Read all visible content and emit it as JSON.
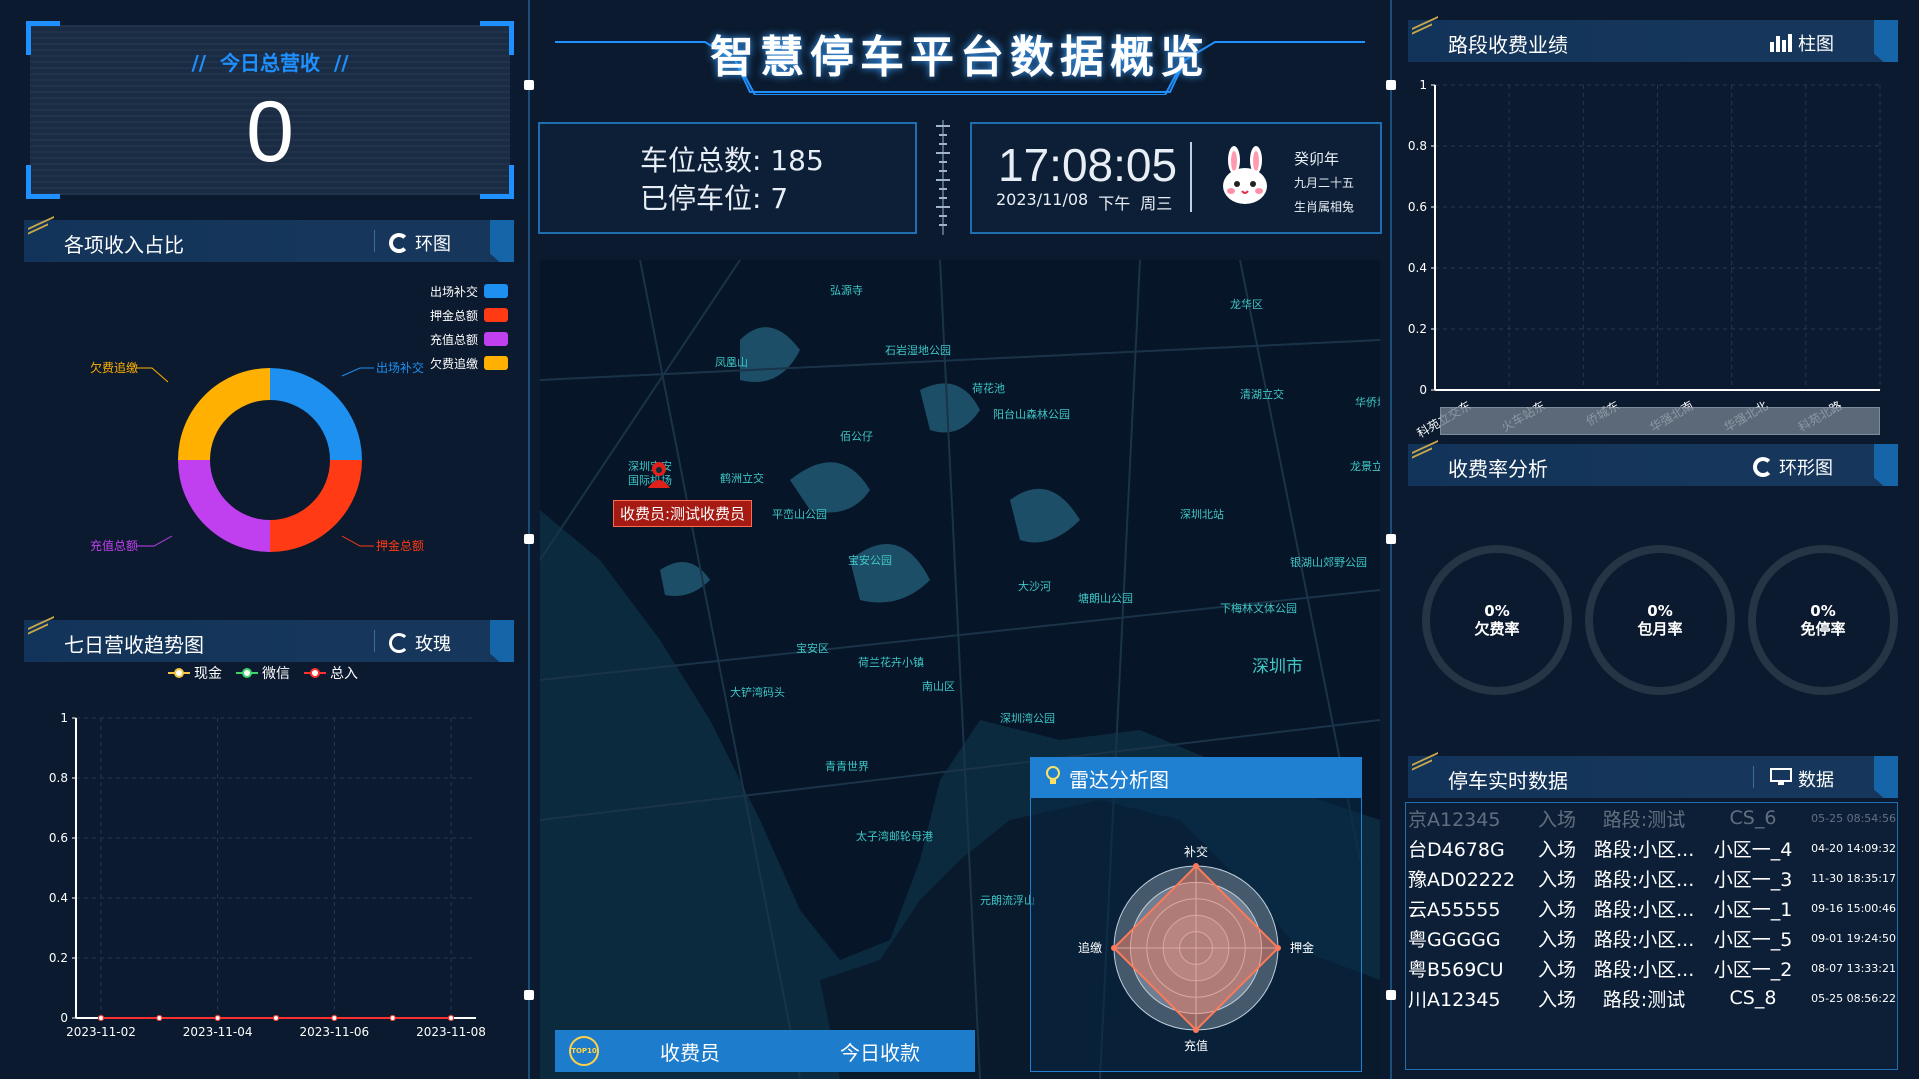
{
  "title": "智慧停车平台数据概览",
  "revenue": {
    "title": "今日总营收",
    "value": "0"
  },
  "income_panel": {
    "title": "各项收入占比",
    "switch_label": "环图",
    "legend": [
      {
        "label": "出场补交",
        "color": "#1e90f0"
      },
      {
        "label": "押金总额",
        "color": "#ff3a14"
      },
      {
        "label": "充值总额",
        "color": "#c040f0"
      },
      {
        "label": "欠费追缴",
        "color": "#ffb000"
      }
    ],
    "slice_labels": [
      "欠费追缴",
      "出场补交",
      "充值总额",
      "押金总额"
    ]
  },
  "trend_panel": {
    "title": "七日营收趋势图",
    "switch_label": "玫瑰",
    "legend": [
      {
        "label": "现金",
        "color": "#f5c542"
      },
      {
        "label": "微信",
        "color": "#3fd36b"
      },
      {
        "label": "总入",
        "color": "#ff3030"
      }
    ],
    "y_ticks": [
      "1",
      "0.8",
      "0.6",
      "0.4",
      "0.2",
      "0"
    ],
    "x_ticks": [
      "2023-11-02",
      "2023-11-04",
      "2023-11-06",
      "2023-11-08"
    ]
  },
  "stats": {
    "total_spaces": "车位总数: 185",
    "occupied": "已停车位: 7"
  },
  "clock": {
    "time": "17:08:05",
    "date": "2023/11/08",
    "ampm": "下午",
    "weekday": "周三",
    "lunar_year": "癸卯年",
    "lunar_date": "九月二十五",
    "zodiac": "生肖属相兔"
  },
  "map": {
    "labels": [
      {
        "text": "弘源寺"
      },
      {
        "text": "石岩湿地公园"
      },
      {
        "text": "凤凰山"
      },
      {
        "text": "荷花池"
      },
      {
        "text": "阳台山森林公园"
      },
      {
        "text": "清湖立交"
      },
      {
        "text": "华侨城"
      },
      {
        "text": "佰公仔"
      },
      {
        "text": "深圳宝安"
      },
      {
        "text": "国际机场"
      },
      {
        "text": "鹤洲立交"
      },
      {
        "text": "平峦山公园"
      },
      {
        "text": "深圳北站"
      },
      {
        "text": "银湖山郊野公园"
      },
      {
        "text": "塘朗山公园"
      },
      {
        "text": "下梅林文体公园"
      },
      {
        "text": "宝安区"
      },
      {
        "text": "荷兰花卉小镇"
      },
      {
        "text": "大铲湾码头"
      },
      {
        "text": "南山区"
      },
      {
        "text": "深圳湾公园"
      },
      {
        "text": "青青世界"
      },
      {
        "text": "太子湾邮轮母港"
      },
      {
        "text": "元朗流浮山"
      },
      {
        "text": "深圳市"
      },
      {
        "text": "大沙河"
      },
      {
        "text": "龙华区"
      },
      {
        "text": "龙景立"
      },
      {
        "text": "宝安公园"
      }
    ],
    "collector_label": "收费员:测试收费员"
  },
  "radar": {
    "title": "雷达分析图",
    "axes": [
      "补交",
      "押金",
      "充值",
      "追缴"
    ],
    "chart_data": {
      "type": "radar",
      "axes": [
        "补交",
        "押金",
        "充值",
        "追缴"
      ],
      "values": [
        1,
        1,
        1,
        1
      ]
    }
  },
  "top10": {
    "col1": "收费员",
    "col2": "今日收款",
    "badge": "TOP10"
  },
  "segment_panel": {
    "title": "路段收费业绩",
    "switch_label": "柱图",
    "y_ticks": [
      "1",
      "0.8",
      "0.6",
      "0.4",
      "0.2",
      "0"
    ],
    "x_ticks": [
      "科苑立交东",
      "火车站东",
      "侨城东",
      "华强北南",
      "华强北北",
      "科苑北路"
    ]
  },
  "rate_panel": {
    "title": "收费率分析",
    "switch_label": "环形图",
    "gauges": [
      {
        "value": "0%",
        "label": "欠费率"
      },
      {
        "value": "0%",
        "label": "包月率"
      },
      {
        "value": "0%",
        "label": "免停率"
      }
    ]
  },
  "realtime_panel": {
    "title": "停车实时数据",
    "switch_label": "数据",
    "rows": [
      {
        "plate": "京A12345",
        "dir": "入场",
        "segment": "路段:测试",
        "zone": "CS_6",
        "time": "05-25 08:54:56"
      },
      {
        "plate": "台D4678G",
        "dir": "入场",
        "segment": "路段:小区...",
        "zone": "小区一_4",
        "time": "04-20 14:09:32"
      },
      {
        "plate": "豫AD02222",
        "dir": "入场",
        "segment": "路段:小区...",
        "zone": "小区一_3",
        "time": "11-30 18:35:17"
      },
      {
        "plate": "云A55555",
        "dir": "入场",
        "segment": "路段:小区...",
        "zone": "小区一_1",
        "time": "09-16 15:00:46"
      },
      {
        "plate": "粤GGGGG",
        "dir": "入场",
        "segment": "路段:小区...",
        "zone": "小区一_5",
        "time": "09-01 19:24:50"
      },
      {
        "plate": "粤B569CU",
        "dir": "入场",
        "segment": "路段:小区...",
        "zone": "小区一_2",
        "time": "08-07 13:33:21"
      },
      {
        "plate": "川A12345",
        "dir": "入场",
        "segment": "路段:测试",
        "zone": "CS_8",
        "time": "05-25 08:56:22"
      }
    ]
  },
  "chart_data": [
    {
      "type": "pie",
      "title": "各项收入占比",
      "categories": [
        "出场补交",
        "押金总额",
        "充值总额",
        "欠费追缴"
      ],
      "values": [
        25,
        25,
        25,
        25
      ]
    },
    {
      "type": "line",
      "title": "七日营收趋势图",
      "x": [
        "2023-11-02",
        "2023-11-03",
        "2023-11-04",
        "2023-11-05",
        "2023-11-06",
        "2023-11-07",
        "2023-11-08"
      ],
      "series": [
        {
          "name": "现金",
          "values": [
            0,
            0,
            0,
            0,
            0,
            0,
            0
          ]
        },
        {
          "name": "微信",
          "values": [
            0,
            0,
            0,
            0,
            0,
            0,
            0
          ]
        },
        {
          "name": "总入",
          "values": [
            0,
            0,
            0,
            0,
            0,
            0,
            0
          ]
        }
      ],
      "ylim": [
        0,
        1
      ]
    },
    {
      "type": "bar",
      "title": "路段收费业绩",
      "categories": [
        "科苑立交东",
        "火车站东",
        "侨城东",
        "华强北南",
        "华强北北",
        "科苑北路"
      ],
      "values": [
        0,
        0,
        0,
        0,
        0,
        0
      ],
      "ylim": [
        0,
        1
      ]
    }
  ]
}
